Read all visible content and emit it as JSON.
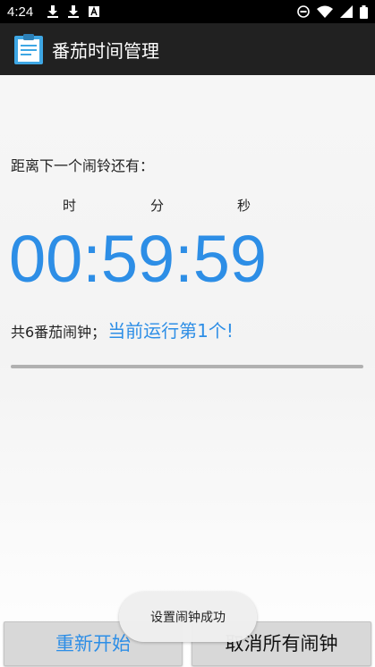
{
  "status_bar": {
    "time": "4:24",
    "icons_left": [
      "download-icon",
      "download-icon",
      "text-icon"
    ],
    "icons_right": [
      "dnd-icon",
      "wifi-icon",
      "signal-icon",
      "battery-icon"
    ]
  },
  "app_bar": {
    "title": "番茄时间管理",
    "icon": "clipboard-icon"
  },
  "countdown": {
    "label": "距离下一个闹铃还有：",
    "unit_hour": "时",
    "unit_minute": "分",
    "unit_second": "秒",
    "time": "00:59:59"
  },
  "alarm_info": {
    "total": "共6番茄闹钟；",
    "current": "当前运行第1个!"
  },
  "buttons": {
    "restart": "重新开始",
    "cancel_all": "取消所有闹钟"
  },
  "toast": {
    "message": "设置闹钟成功"
  },
  "colors": {
    "accent": "#2d8ee6",
    "app_bar": "#212121",
    "status_bar": "#000000"
  }
}
